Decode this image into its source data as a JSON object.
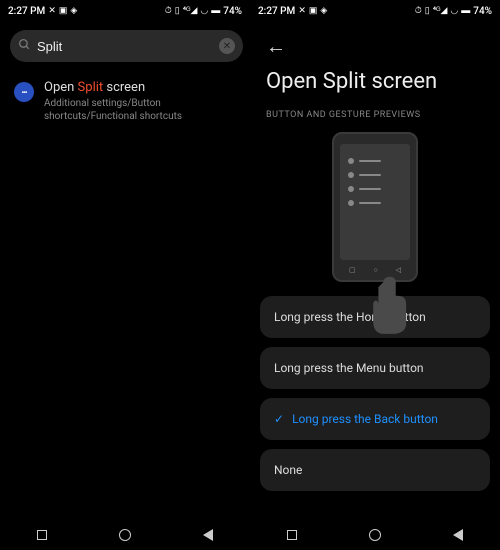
{
  "status": {
    "time": "2:27 PM",
    "battery": "74%"
  },
  "left": {
    "search_value": "Split",
    "cancel": "Cancel",
    "result": {
      "title_pre": "Open ",
      "title_hl": "Split",
      "title_post": " screen",
      "path": "Additional settings/Button shortcuts/Functional shortcuts"
    }
  },
  "right": {
    "title": "Open Split screen",
    "section": "BUTTON AND GESTURE PREVIEWS",
    "options": {
      "o1": "Long press the Home button",
      "o2": "Long press the Menu button",
      "o3": "Long press the Back button",
      "o4": "None"
    }
  }
}
